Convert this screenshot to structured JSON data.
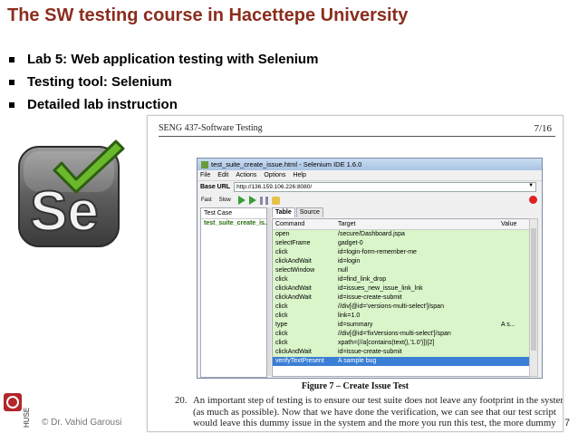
{
  "slide": {
    "title": "The SW testing course in Hacettepe University",
    "bullets": [
      "Lab 5: Web application testing with Selenium",
      "Testing tool: Selenium",
      "Detailed lab instruction"
    ],
    "logo_text": "Se",
    "footer_logo_text": "HUSE",
    "footer_credit": "© Dr. Vahid Garousi",
    "page_number": "7",
    "colors": {
      "title": "#8b2d1e",
      "logo_check": "#6ab82b",
      "footer_logo": "#b3262a"
    }
  },
  "document": {
    "header": "SENG 437-Software Testing",
    "page": "7/16",
    "figure_caption": "Figure 7 – Create Issue Test",
    "para_number": "20.",
    "para_lines": [
      "An important step of testing is to ensure our test suite does not leave any footprint in the system",
      "(as much as possible). Now that we have done the verification, we can see that our test script",
      "would leave this dummy issue in the system and the more you run this test, the more dummy"
    ]
  },
  "ide": {
    "title": "test_suite_create_issue.html - Selenium IDE 1.6.0",
    "menu": [
      "File",
      "Edit",
      "Actions",
      "Options",
      "Help"
    ],
    "base_url_label": "Base URL",
    "base_url": "http://136.159.106.226:8080/",
    "speed_fast": "Fast",
    "speed_slow": "Slow",
    "test_case_header": "Test Case",
    "test_case_item": "test_suite_create_is...",
    "tabs": [
      "Table",
      "Source"
    ],
    "columns": [
      "Command",
      "Target",
      "Value"
    ],
    "rows": [
      {
        "command": "open",
        "target": "/secure/Dashboard.jspa",
        "value": ""
      },
      {
        "command": "selectFrame",
        "target": "gadget-0",
        "value": ""
      },
      {
        "command": "click",
        "target": "id=login-form-remember-me",
        "value": ""
      },
      {
        "command": "clickAndWait",
        "target": "id=login",
        "value": ""
      },
      {
        "command": "selectWindow",
        "target": "null",
        "value": ""
      },
      {
        "command": "click",
        "target": "id=find_link_drop",
        "value": ""
      },
      {
        "command": "clickAndWait",
        "target": "id=issues_new_issue_link_lnk",
        "value": ""
      },
      {
        "command": "clickAndWait",
        "target": "id=issue-create-submit",
        "value": ""
      },
      {
        "command": "click",
        "target": "//div[@id='versions-multi-select']/span",
        "value": ""
      },
      {
        "command": "click",
        "target": "link=1.0",
        "value": ""
      },
      {
        "command": "type",
        "target": "id=summary",
        "value": "A s..."
      },
      {
        "command": "click",
        "target": "//div[@id='fixVersions-multi-select']/span",
        "value": ""
      },
      {
        "command": "click",
        "target": "xpath=(//a[contains(text(),'1.0')])[2]",
        "value": ""
      },
      {
        "command": "clickAndWait",
        "target": "id=issue-create-submit",
        "value": ""
      },
      {
        "command": "verifyTextPresent",
        "target": "A sample bug",
        "value": ""
      }
    ]
  }
}
